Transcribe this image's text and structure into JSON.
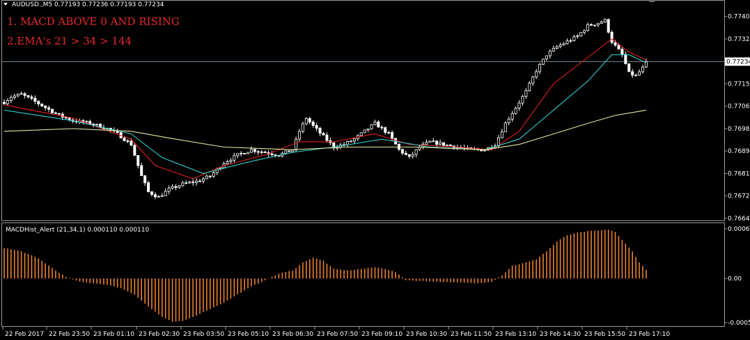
{
  "header": {
    "symbol_line": "AUDUSD.,M5  0.77193 0.77236 0.77193 0.77234",
    "dropdown_icon": "triangle-down-icon"
  },
  "annotations": [
    "1. MACD ABOVE 0 AND RISING",
    "2.EMA's 21 > 34 > 144"
  ],
  "current_price_label": "0.77234",
  "colors": {
    "background": "#000000",
    "candle_up": "#ffffff",
    "candle_down": "#ffffff",
    "ema_21": "#e02020",
    "ema_34": "#33cccc",
    "ema_144": "#e8e8a0",
    "macd_hist": "#e8822e",
    "grid_frame": "#9a9a9a",
    "annotation": "#e8282d"
  },
  "macd_panel": {
    "title": "MACDHist_Alert (21,34,1)  0.000110 0.000110"
  },
  "chart_data": [
    {
      "type": "candlestick",
      "symbol": "AUDUSD.",
      "timeframe": "M5",
      "ohlc_last": {
        "open": 0.77193,
        "high": 0.77236,
        "low": 0.77193,
        "close": 0.77234
      },
      "x_ticks": [
        "22 Feb 2017",
        "22 Feb 23:50",
        "23 Feb 01:10",
        "23 Feb 02:30",
        "23 Feb 03:50",
        "23 Feb 05:10",
        "23 Feb 06:30",
        "23 Feb 07:50",
        "23 Feb 09:10",
        "23 Feb 10:30",
        "23 Feb 11:50",
        "23 Feb 13:10",
        "23 Feb 14:30",
        "23 Feb 15:50",
        "23 Feb 17:10"
      ],
      "y_ticks": [
        "0.77405",
        "0.77320",
        "0.77150",
        "0.77065",
        "0.76980",
        "0.76895",
        "0.76810",
        "0.76725",
        "0.76640"
      ],
      "ylim": [
        0.7664,
        0.7742
      ],
      "price_anchors": [
        [
          0,
          0.7708
        ],
        [
          2,
          0.771
        ],
        [
          5,
          0.7711
        ],
        [
          8,
          0.7709
        ],
        [
          12,
          0.7706
        ],
        [
          16,
          0.7703
        ],
        [
          20,
          0.7701
        ],
        [
          25,
          0.77
        ],
        [
          30,
          0.7698
        ],
        [
          33,
          0.7696
        ],
        [
          37,
          0.7692
        ],
        [
          40,
          0.768
        ],
        [
          42,
          0.7674
        ],
        [
          45,
          0.7672
        ],
        [
          48,
          0.7675
        ],
        [
          52,
          0.7677
        ],
        [
          56,
          0.7678
        ],
        [
          60,
          0.768
        ],
        [
          64,
          0.7685
        ],
        [
          68,
          0.7688
        ],
        [
          72,
          0.769
        ],
        [
          76,
          0.7689
        ],
        [
          80,
          0.7688
        ],
        [
          84,
          0.769
        ],
        [
          86,
          0.7697
        ],
        [
          88,
          0.7702
        ],
        [
          90,
          0.7699
        ],
        [
          93,
          0.7695
        ],
        [
          96,
          0.7691
        ],
        [
          99,
          0.7692
        ],
        [
          102,
          0.7694
        ],
        [
          105,
          0.7697
        ],
        [
          108,
          0.77
        ],
        [
          110,
          0.7698
        ],
        [
          112,
          0.7696
        ],
        [
          115,
          0.769
        ],
        [
          118,
          0.7687
        ],
        [
          121,
          0.7691
        ],
        [
          124,
          0.7693
        ],
        [
          128,
          0.7692
        ],
        [
          132,
          0.7691
        ],
        [
          136,
          0.769
        ],
        [
          140,
          0.769
        ],
        [
          143,
          0.7692
        ],
        [
          146,
          0.77
        ],
        [
          149,
          0.7706
        ],
        [
          152,
          0.7712
        ],
        [
          155,
          0.772
        ],
        [
          158,
          0.7726
        ],
        [
          161,
          0.7729
        ],
        [
          164,
          0.7731
        ],
        [
          167,
          0.7733
        ],
        [
          170,
          0.7737
        ],
        [
          173,
          0.7738
        ],
        [
          175,
          0.7739
        ],
        [
          177,
          0.7731
        ],
        [
          180,
          0.7726
        ],
        [
          182,
          0.7719
        ],
        [
          184,
          0.7718
        ],
        [
          186,
          0.7721
        ],
        [
          187,
          0.7723
        ]
      ],
      "series": [
        {
          "name": "EMA 21",
          "color": "#e02020",
          "points": [
            [
              0,
              0.7707
            ],
            [
              20,
              0.7702
            ],
            [
              37,
              0.7694
            ],
            [
              44,
              0.7684
            ],
            [
              55,
              0.7679
            ],
            [
              64,
              0.7684
            ],
            [
              76,
              0.7688
            ],
            [
              86,
              0.7693
            ],
            [
              96,
              0.7693
            ],
            [
              108,
              0.7696
            ],
            [
              118,
              0.7692
            ],
            [
              132,
              0.7691
            ],
            [
              142,
              0.769
            ],
            [
              150,
              0.7697
            ],
            [
              160,
              0.7715
            ],
            [
              170,
              0.7725
            ],
            [
              177,
              0.7732
            ],
            [
              182,
              0.7727
            ],
            [
              187,
              0.7724
            ]
          ]
        },
        {
          "name": "EMA 34",
          "color": "#33cccc",
          "points": [
            [
              0,
              0.7705
            ],
            [
              20,
              0.7701
            ],
            [
              37,
              0.7696
            ],
            [
              46,
              0.7687
            ],
            [
              58,
              0.7681
            ],
            [
              70,
              0.7685
            ],
            [
              84,
              0.7689
            ],
            [
              96,
              0.7691
            ],
            [
              110,
              0.7694
            ],
            [
              124,
              0.7691
            ],
            [
              140,
              0.769
            ],
            [
              150,
              0.7694
            ],
            [
              160,
              0.7705
            ],
            [
              170,
              0.7716
            ],
            [
              177,
              0.7726
            ],
            [
              182,
              0.7726
            ],
            [
              187,
              0.7723
            ]
          ]
        },
        {
          "name": "EMA 144",
          "color": "#e8e8a0",
          "points": [
            [
              0,
              0.7697
            ],
            [
              20,
              0.7698
            ],
            [
              37,
              0.7697
            ],
            [
              50,
              0.7694
            ],
            [
              64,
              0.7691
            ],
            [
              84,
              0.769
            ],
            [
              100,
              0.7691
            ],
            [
              120,
              0.7691
            ],
            [
              140,
              0.769
            ],
            [
              150,
              0.7692
            ],
            [
              160,
              0.7696
            ],
            [
              170,
              0.77
            ],
            [
              178,
              0.7703
            ],
            [
              187,
              0.7705
            ]
          ]
        }
      ]
    },
    {
      "type": "bar",
      "name": "MACDHist_Alert (21,34,1)",
      "value": 0.00011,
      "y_ticks": [
        "0.00062",
        "0.00",
        "-0.00055"
      ],
      "ylim": [
        -0.00055,
        0.00062
      ],
      "hist_anchors": [
        [
          0,
          0.00038
        ],
        [
          5,
          0.00034
        ],
        [
          10,
          0.00025
        ],
        [
          15,
          0.0001
        ],
        [
          18,
          2e-05
        ],
        [
          22,
          -4e-05
        ],
        [
          30,
          -8e-05
        ],
        [
          34,
          -0.00012
        ],
        [
          38,
          -0.0002
        ],
        [
          42,
          -0.00035
        ],
        [
          46,
          -0.00048
        ],
        [
          49,
          -0.00054
        ],
        [
          52,
          -0.00053
        ],
        [
          56,
          -0.00046
        ],
        [
          60,
          -0.00038
        ],
        [
          64,
          -0.0003
        ],
        [
          68,
          -0.0002
        ],
        [
          72,
          -0.0001
        ],
        [
          76,
          -2e-05
        ],
        [
          80,
          6e-05
        ],
        [
          84,
          0.0001
        ],
        [
          87,
          0.0002
        ],
        [
          90,
          0.00026
        ],
        [
          93,
          0.00022
        ],
        [
          96,
          0.00012
        ],
        [
          100,
          0.0001
        ],
        [
          104,
          0.00012
        ],
        [
          108,
          0.00014
        ],
        [
          111,
          0.00012
        ],
        [
          114,
          8e-05
        ],
        [
          117,
          -2e-05
        ],
        [
          121,
          -3e-05
        ],
        [
          126,
          -4e-05
        ],
        [
          132,
          -5e-05
        ],
        [
          138,
          -6e-05
        ],
        [
          142,
          -4e-05
        ],
        [
          145,
          4e-05
        ],
        [
          148,
          0.00016
        ],
        [
          152,
          0.0002
        ],
        [
          155,
          0.00024
        ],
        [
          158,
          0.00034
        ],
        [
          161,
          0.00046
        ],
        [
          164,
          0.00054
        ],
        [
          167,
          0.00057
        ],
        [
          170,
          0.00059
        ],
        [
          174,
          0.0006
        ],
        [
          176,
          0.00061
        ],
        [
          178,
          0.00058
        ],
        [
          180,
          0.00048
        ],
        [
          183,
          0.00034
        ],
        [
          185,
          0.0002
        ],
        [
          187,
          0.00011
        ]
      ]
    }
  ]
}
